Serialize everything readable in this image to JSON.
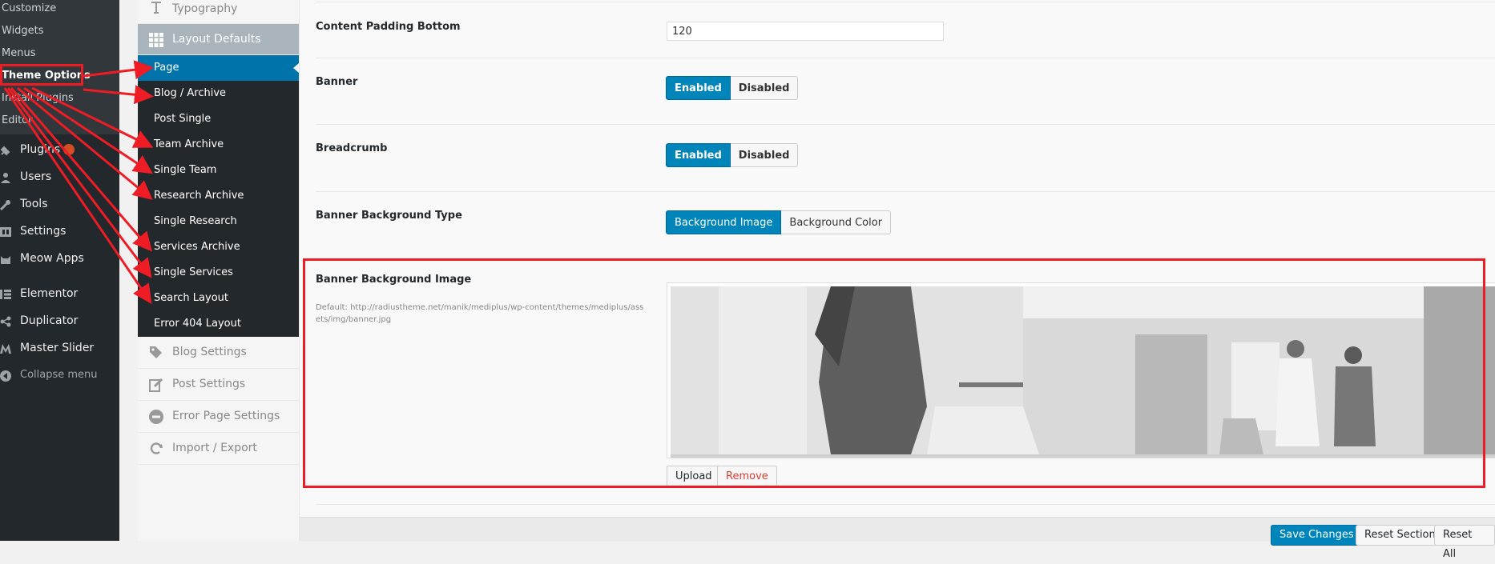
{
  "wp_menu": {
    "submenu": [
      "Customize",
      "Widgets",
      "Menus",
      "Theme Options",
      "Install Plugins",
      "Editor"
    ],
    "items": [
      {
        "label": "Plugins",
        "icon": "plugin-icon",
        "badge": true
      },
      {
        "label": "Users",
        "icon": "users-icon"
      },
      {
        "label": "Tools",
        "icon": "tools-icon"
      },
      {
        "label": "Settings",
        "icon": "settings-icon"
      },
      {
        "label": "Meow Apps",
        "icon": "meow-apps-icon"
      },
      {
        "label": "Elementor",
        "icon": "elementor-icon"
      },
      {
        "label": "Duplicator",
        "icon": "duplicator-icon"
      },
      {
        "label": "Master Slider",
        "icon": "master-slider-icon"
      },
      {
        "label": "Collapse menu",
        "icon": "collapse-icon"
      }
    ]
  },
  "panel": {
    "typography": "Typography",
    "layout_defaults": "Layout Defaults",
    "layout_items": [
      "Page",
      "Blog / Archive",
      "Post Single",
      "Team Archive",
      "Single Team",
      "Research Archive",
      "Single Research",
      "Services Archive",
      "Single Services",
      "Search Layout",
      "Error 404 Layout"
    ],
    "blog_settings": "Blog Settings",
    "post_settings": "Post Settings",
    "error_page_settings": "Error Page Settings",
    "import_export": "Import / Export"
  },
  "fields": {
    "content_padding_bottom": {
      "label": "Content Padding Bottom",
      "value": "120"
    },
    "banner": {
      "label": "Banner",
      "enabled": "Enabled",
      "disabled": "Disabled"
    },
    "breadcrumb": {
      "label": "Breadcrumb",
      "enabled": "Enabled",
      "disabled": "Disabled"
    },
    "banner_bg_type": {
      "label": "Banner Background Type",
      "image": "Background Image",
      "color": "Background Color"
    },
    "banner_bg_image": {
      "label": "Banner Background Image",
      "default": "Default: http://radiustheme.net/manik/mediplus/wp-content/themes/mediplus/assets/img/banner.jpg",
      "upload": "Upload",
      "remove": "Remove"
    }
  },
  "footer": {
    "save": "Save Changes",
    "reset_section": "Reset Section",
    "reset_all": "Reset All"
  },
  "colors": {
    "accent": "#0085ba",
    "highlight": "#ee1c25",
    "admin_bg": "#23282d"
  }
}
